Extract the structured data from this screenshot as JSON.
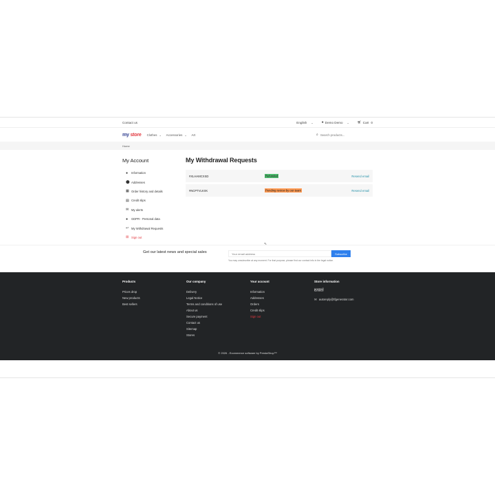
{
  "topbar": {
    "contact": "Contact us",
    "language": "English",
    "user": "Demo Demo",
    "cart": "Cart",
    "cart_count": "0"
  },
  "header": {
    "logo_my": "my",
    "logo_store": "store",
    "nav": [
      "Clothes",
      "Accessories",
      "Art"
    ],
    "search_placeholder": "Search products..."
  },
  "breadcrumb": "Home",
  "sidebar": {
    "title": "My Account",
    "items": [
      {
        "label": "Information",
        "icon": "user-icon"
      },
      {
        "label": "Addresses",
        "icon": "location-pin-icon"
      },
      {
        "label": "Order history and details",
        "icon": "calendar-icon"
      },
      {
        "label": "Credit slips",
        "icon": "credit-slip-icon"
      },
      {
        "label": "My alerts",
        "icon": "mail-icon"
      },
      {
        "label": "GDPR - Personal data",
        "icon": "user-icon"
      },
      {
        "label": "My Withdrawal Requests",
        "icon": "return-arrow-icon"
      },
      {
        "label": "Sign out",
        "icon": "sign-out-icon"
      }
    ]
  },
  "main": {
    "title": "My Withdrawal Requests",
    "requests": [
      {
        "reference": "#XLHAMCXSD",
        "status": "Refunded",
        "status_color": "#4cbb6c",
        "action": "Resend email"
      },
      {
        "reference": "#NCPTVLKXK",
        "status": "Pending review by our team",
        "status_color": "#ff9a52",
        "action": "Resend email"
      }
    ]
  },
  "newsletter": {
    "title": "Get our latest news and special sales",
    "placeholder": "Your email address",
    "button": "Subscribe",
    "note": "You may unsubscribe at any moment. For that purpose, please find our contact info in the legal notice."
  },
  "footer": {
    "products": {
      "title": "Products",
      "links": [
        "Prices drop",
        "New products",
        "Best sellers"
      ]
    },
    "company": {
      "title": "Our company",
      "links": [
        "Delivery",
        "Legal Notice",
        "Terms and conditions of use",
        "About us",
        "Secure payment",
        "Contact us",
        "Sitemap",
        "Stores"
      ]
    },
    "account": {
      "title": "Your account",
      "links": [
        "Information",
        "Addresses",
        "Orders",
        "Credit slips",
        "Sign out"
      ]
    },
    "store": {
      "title": "Store information",
      "lines": [
        "prestall",
        "Greece"
      ],
      "email": "autoreply@tfgenerator.com"
    },
    "copyright": "© 2026 - Ecommerce software by PrestaShop™"
  },
  "colors": {
    "accent": "#2f80ed",
    "link": "#2592a9",
    "danger": "#e2383f",
    "footer_bg": "#222426"
  }
}
